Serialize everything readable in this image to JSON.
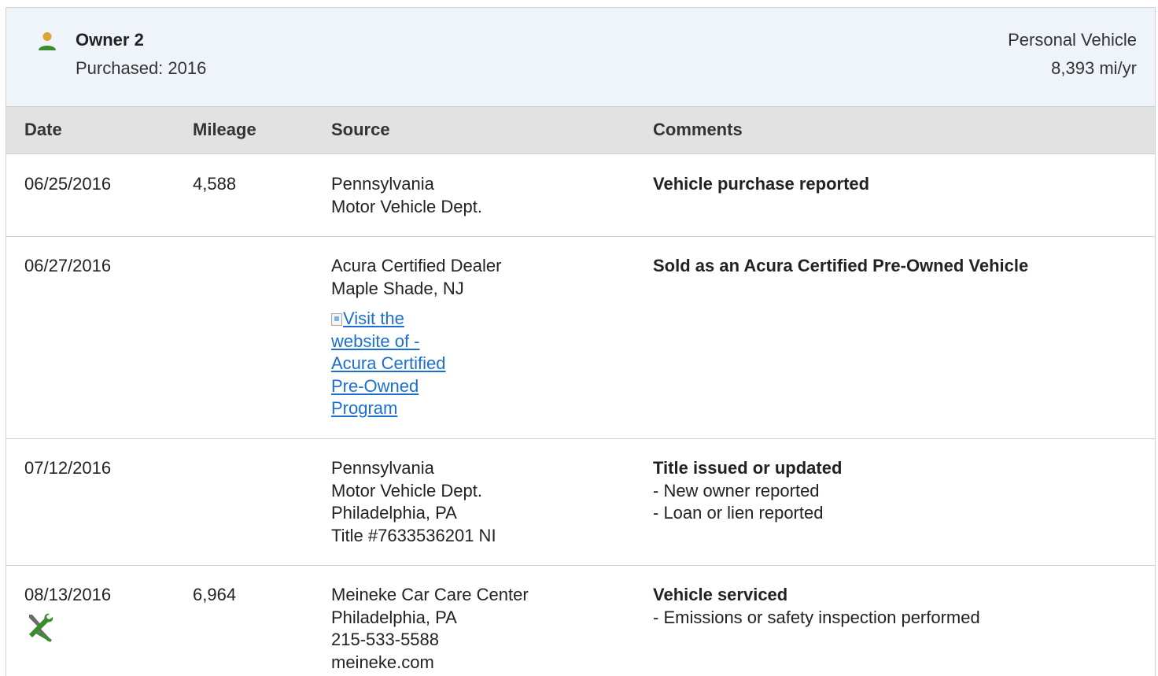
{
  "owner": {
    "title": "Owner 2",
    "purchased": "Purchased: 2016",
    "vehicle_type": "Personal Vehicle",
    "miles_per_year": "8,393 mi/yr",
    "icon": "person-icon",
    "icon_color": "#3a8a2e"
  },
  "columns": {
    "date": "Date",
    "mileage": "Mileage",
    "source": "Source",
    "comments": "Comments"
  },
  "rows": [
    {
      "date": "06/25/2016",
      "mileage": "4,588",
      "source": [
        "Pennsylvania",
        "Motor Vehicle Dept."
      ],
      "comment_title": "Vehicle purchase reported",
      "comment_items": []
    },
    {
      "date": "06/27/2016",
      "mileage": "",
      "source": [
        "Acura Certified Dealer",
        "Maple Shade, NJ"
      ],
      "link_lines": [
        "Visit the",
        "website of -",
        "Acura Certified",
        "Pre-Owned",
        "Program"
      ],
      "comment_title": "Sold as an Acura Certified Pre-Owned Vehicle",
      "comment_items": []
    },
    {
      "date": "07/12/2016",
      "mileage": "",
      "source": [
        "Pennsylvania",
        "Motor Vehicle Dept.",
        "Philadelphia, PA",
        "Title #7633536201 NI"
      ],
      "comment_title": "Title issued or updated",
      "comment_items": [
        "- New owner reported",
        "- Loan or lien reported"
      ]
    },
    {
      "date": "08/13/2016",
      "mileage": "6,964",
      "source": [
        "Meineke Car Care Center",
        "Philadelphia, PA",
        "215-533-5588",
        "meineke.com"
      ],
      "comment_title": "Vehicle serviced",
      "comment_items": [
        "- Emissions or safety inspection performed"
      ],
      "icon": "service-wrench-icon"
    }
  ],
  "colors": {
    "header_bg": "#eef4fa",
    "table_head_bg": "#e2e2e2",
    "link": "#1a6fd1",
    "wrench_green": "#3a8a2e",
    "wrench_gray": "#6b6b6b"
  }
}
